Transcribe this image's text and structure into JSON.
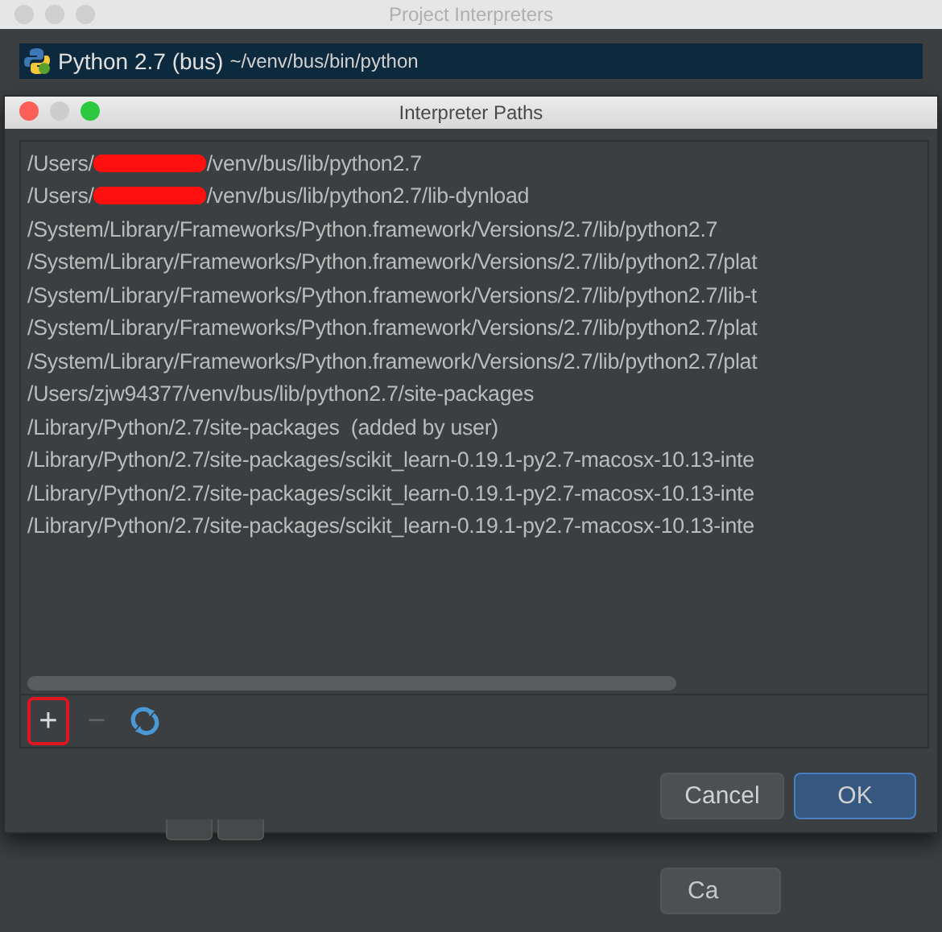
{
  "back_window": {
    "title": "Project Interpreters",
    "interpreter": {
      "name": "Python 2.7 (bus)",
      "path": "~/venv/bus/bin/python",
      "selected": true
    },
    "button": "Ca"
  },
  "dialog": {
    "title": "Interpreter Paths",
    "paths": [
      {
        "text": "/Users/",
        "redacted": true,
        "rest": "/venv/bus/lib/python2.7"
      },
      {
        "text": "/Users/",
        "redacted": true,
        "rest": "/venv/bus/lib/python2.7/lib-dynload"
      },
      {
        "text": "/System/Library/Frameworks/Python.framework/Versions/2.7/lib/python2.7",
        "redacted": false
      },
      {
        "text": "/System/Library/Frameworks/Python.framework/Versions/2.7/lib/python2.7/plat",
        "redacted": false
      },
      {
        "text": "/System/Library/Frameworks/Python.framework/Versions/2.7/lib/python2.7/lib-t",
        "redacted": false
      },
      {
        "text": "/System/Library/Frameworks/Python.framework/Versions/2.7/lib/python2.7/plat",
        "redacted": false
      },
      {
        "text": "/System/Library/Frameworks/Python.framework/Versions/2.7/lib/python2.7/plat",
        "redacted": false
      },
      {
        "text": "/Users/zjw94377/venv/bus/lib/python2.7/site-packages",
        "redacted": false
      },
      {
        "text": "/Library/Python/2.7/site-packages  (added by user)",
        "redacted": false
      },
      {
        "text": "/Library/Python/2.7/site-packages/scikit_learn-0.19.1-py2.7-macosx-10.13-inte",
        "redacted": false
      },
      {
        "text": "/Library/Python/2.7/site-packages/scikit_learn-0.19.1-py2.7-macosx-10.13-inte",
        "redacted": false
      },
      {
        "text": "/Library/Python/2.7/site-packages/scikit_learn-0.19.1-py2.7-macosx-10.13-inte",
        "redacted": false
      }
    ],
    "tools": [
      {
        "kind": "add",
        "label": "+",
        "disabled": false,
        "highlighted": true
      },
      {
        "kind": "remove",
        "label": "−",
        "disabled": true,
        "highlighted": false
      },
      {
        "kind": "reload",
        "disabled": false,
        "highlighted": false
      }
    ],
    "buttons": [
      {
        "label": "Cancel",
        "default": false
      },
      {
        "label": "OK",
        "default": true
      }
    ]
  }
}
